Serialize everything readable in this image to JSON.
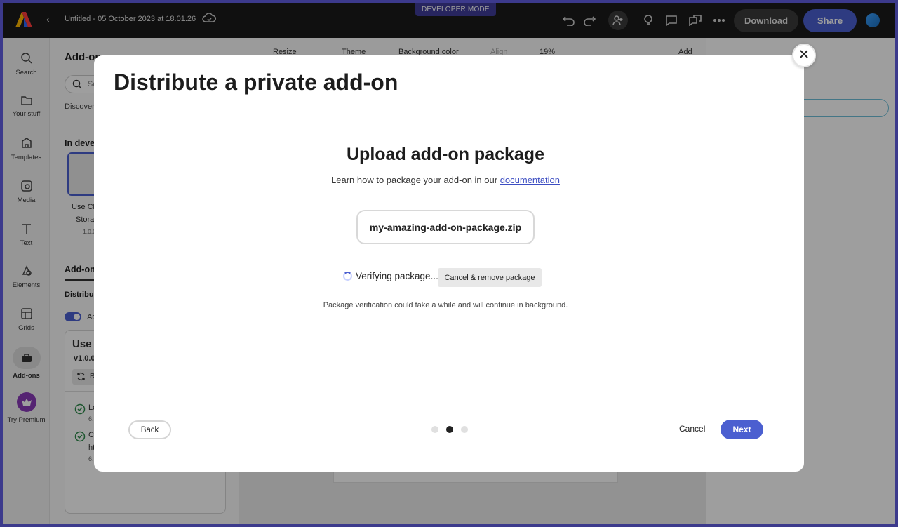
{
  "app": {
    "developer_mode_badge": "DEVELOPER MODE",
    "document_title": "Untitled - 05 October 2023 at 18.01.26",
    "download_label": "Download",
    "share_label": "Share"
  },
  "rail": {
    "items": [
      {
        "label": "Search",
        "icon": "search-icon"
      },
      {
        "label": "Your stuff",
        "icon": "folder-icon"
      },
      {
        "label": "Templates",
        "icon": "templates-icon"
      },
      {
        "label": "Media",
        "icon": "media-icon"
      },
      {
        "label": "Text",
        "icon": "text-icon"
      },
      {
        "label": "Elements",
        "icon": "elements-icon"
      },
      {
        "label": "Grids",
        "icon": "grids-icon"
      },
      {
        "label": "Add-ons",
        "icon": "addons-icon",
        "active": true
      },
      {
        "label": "Try Premium",
        "icon": "crown-icon"
      }
    ]
  },
  "panel": {
    "title": "Add-ons",
    "search_placeholder": "Se",
    "tab_discover": "Discover",
    "in_development_heading": "In deve",
    "card_name_line1": "Use Cli",
    "card_name_line2": "Stora",
    "card_version": "1.0.0",
    "addons_heading": "Add-on",
    "distribute_heading": "Distribu",
    "toggle_label": "Ac",
    "detail_title": "Use C",
    "detail_version": "v1.0.0",
    "reload_label": "R",
    "log1_title": "Lo",
    "log1_time": "6:",
    "log2_title": "Co",
    "log2_sub": "ht",
    "log2_time": "6:"
  },
  "canvas_toolbar": {
    "resize": "Resize",
    "theme": "Theme",
    "background_color": "Background color",
    "align": "Align",
    "zoom": "19%",
    "add": "Add"
  },
  "modal": {
    "title": "Distribute a private add-on",
    "upload_title": "Upload add-on package",
    "learn_text": "Learn how to package your add-on in our",
    "learn_link": "documentation",
    "filename": "my-amazing-add-on-package.zip",
    "verifying_text": "Verifying package...",
    "cancel_remove_label": "Cancel & remove package",
    "note": "Package verification could take a while and will continue in background.",
    "back_label": "Back",
    "cancel_label": "Cancel",
    "next_label": "Next",
    "steps_total": 3,
    "current_step": 2
  },
  "colors": {
    "accent": "#4b5fd0",
    "topbar": "#1b1b1b",
    "badge": "#403d99"
  }
}
